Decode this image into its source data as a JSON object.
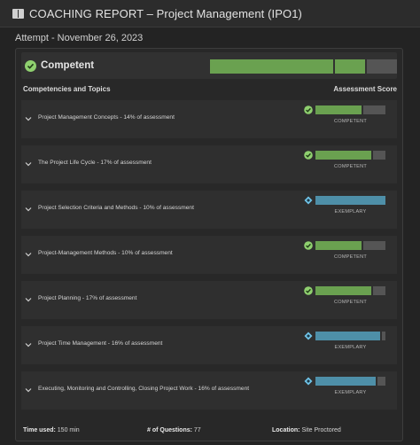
{
  "header": {
    "title": "COACHING REPORT – Project Management (IPO1)"
  },
  "attempt": "Attempt - November 26, 2023",
  "summary": {
    "status": "Competent",
    "bar": [
      {
        "fraction": 0.66,
        "color": "#6aa150"
      },
      {
        "fraction": 0.17,
        "color": "#6aa150"
      },
      {
        "fraction": 0.17,
        "color": "#555555"
      }
    ]
  },
  "columns": {
    "left": "Competencies and Topics",
    "right": "Assessment Score"
  },
  "colors": {
    "competent": "#6aa150",
    "competent_icon": "#8fd06f",
    "exemplary": "#4e8fa8",
    "exemplary_icon": "#6fc4e8",
    "track": "#555555"
  },
  "topics": [
    {
      "label": "Project Management Concepts - 14% of assessment",
      "status": "COMPETENT",
      "icon": "check-icon",
      "kind": "competent",
      "fill": 0.66
    },
    {
      "label": "The Project Life Cycle - 17% of assessment",
      "status": "COMPETENT",
      "icon": "check-icon",
      "kind": "competent",
      "fill": 0.8
    },
    {
      "label": "Project Selection Criteria and Methods - 10% of assessment",
      "status": "EXEMPLARY",
      "icon": "diamond-icon",
      "kind": "exemplary",
      "fill": 1.0
    },
    {
      "label": "Project-Management Methods - 10% of assessment",
      "status": "COMPETENT",
      "icon": "check-icon",
      "kind": "competent",
      "fill": 0.66
    },
    {
      "label": "Project Planning - 17% of assessment",
      "status": "COMPETENT",
      "icon": "check-icon",
      "kind": "competent",
      "fill": 0.8
    },
    {
      "label": "Project Time Management - 16% of assessment",
      "status": "EXEMPLARY",
      "icon": "diamond-icon",
      "kind": "exemplary",
      "fill": 0.92
    },
    {
      "label": "Executing, Monitoring and Controlling, Closing Project Work - 16% of assessment",
      "status": "EXEMPLARY",
      "icon": "diamond-icon",
      "kind": "exemplary",
      "fill": 0.86
    }
  ],
  "footer": {
    "time_label": "Time used:",
    "time_value": "150 min",
    "questions_label": "# of Questions:",
    "questions_value": "77",
    "location_label": "Location:",
    "location_value": "Site Proctored"
  }
}
